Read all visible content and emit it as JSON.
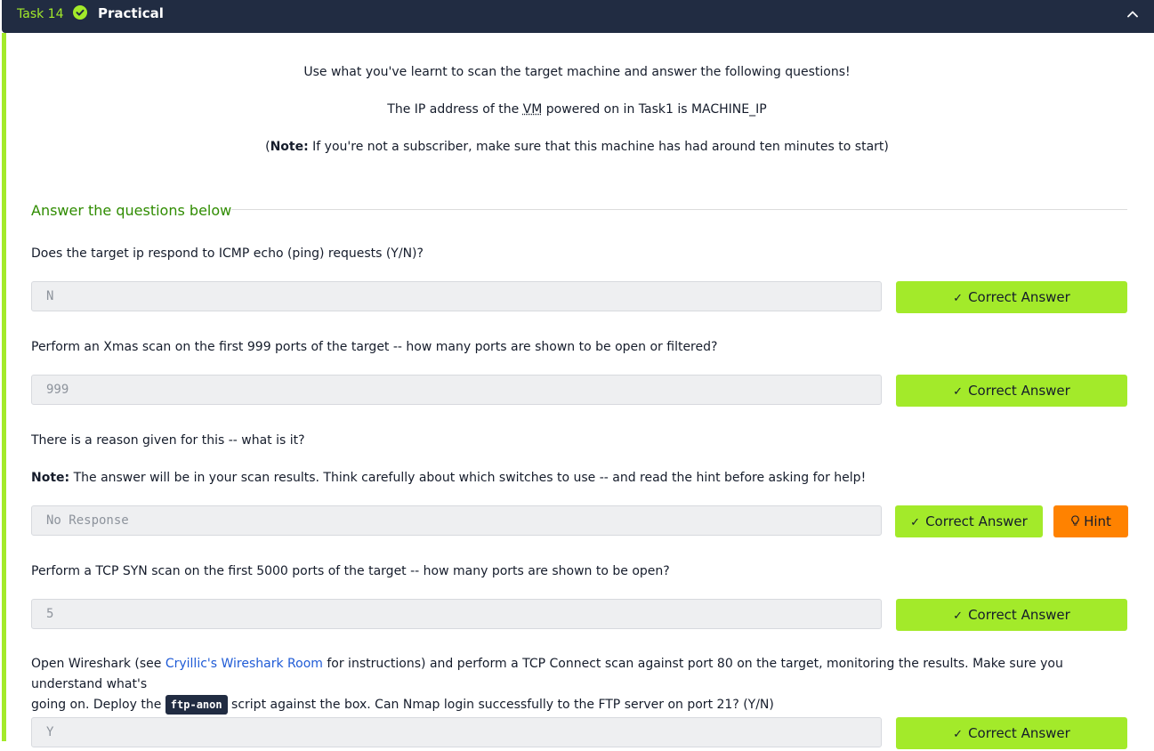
{
  "task": {
    "number": "Task 14",
    "title": "Practical",
    "status": "completed",
    "accent_color": "#a3ea2a",
    "header_bg": "#212c42"
  },
  "intro": {
    "line1": "Use what you've learnt to scan the target machine and answer the following questions!",
    "line2_prefix": "The IP address of the ",
    "line2_abbr": "VM",
    "line2_suffix": " powered on in Task1 is MACHINE_IP",
    "note_open": "(",
    "note_label": "Note:",
    "note_text": " If you're not a subscriber, make sure that this machine has had around ten minutes to start)"
  },
  "answers_heading": "Answer the questions below",
  "questions": [
    {
      "text": "Does the target ip respond to ICMP echo (ping) requests (Y/N)?",
      "answer": "N",
      "button": "Correct Answer"
    },
    {
      "text": "Perform an Xmas scan on the first 999 ports of the target -- how many ports are shown to be open or filtered?",
      "answer": "999",
      "button": "Correct Answer"
    },
    {
      "text": "There is a reason given for this -- what is it?",
      "note_label": "Note:",
      "note_text": " The answer will be in your scan results. Think carefully about which switches to use -- and read the hint before asking for help!",
      "answer": "No Response",
      "button": "Correct Answer",
      "hint": "Hint"
    },
    {
      "text": "Perform a TCP SYN scan on the first 5000 ports of the target -- how many ports are shown to be open?",
      "answer": "5",
      "button": "Correct Answer"
    },
    {
      "text_prefix": "Open Wireshark (see ",
      "link": "Cryillic's Wireshark Room",
      "text_mid": " for instructions) and perform a TCP Connect scan against port 80 on the target, monitoring the results. Make sure you understand what's",
      "text_line2_prefix": "going on. Deploy the ",
      "code": "ftp-anon",
      "text_line2_suffix": " script against the box. Can Nmap login successfully to the FTP server on port 21? (Y/N)",
      "answer": "Y",
      "button": "Correct Answer"
    }
  ],
  "icons": {
    "status": "check-circle-icon",
    "collapse": "chevron-up-icon",
    "button_tick": "checkmark-icon",
    "hint": "lightbulb-icon"
  }
}
